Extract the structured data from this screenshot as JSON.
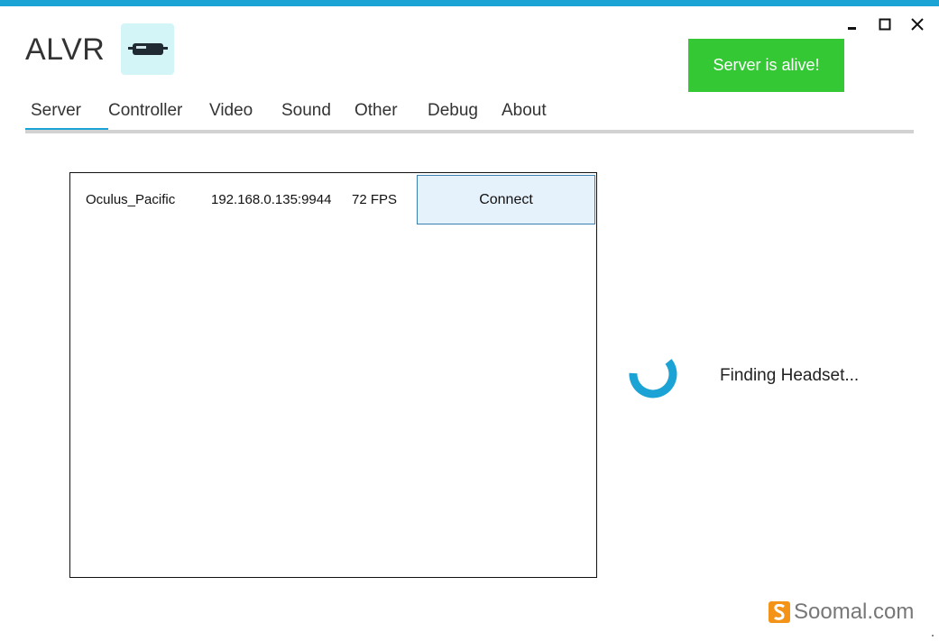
{
  "window": {
    "title": "ALVR",
    "controls": [
      "minimize-icon",
      "maximize-icon",
      "close-icon"
    ]
  },
  "status": {
    "label": "Server is alive!",
    "color": "#34c934"
  },
  "tabs": [
    {
      "label": "Server",
      "active": true
    },
    {
      "label": "Controller"
    },
    {
      "label": "Video"
    },
    {
      "label": "Sound"
    },
    {
      "label": "Other"
    },
    {
      "label": "Debug"
    },
    {
      "label": "About"
    }
  ],
  "devices": [
    {
      "name": "Oculus_Pacific",
      "address": "192.168.0.135:9944",
      "fps": "72 FPS",
      "action": "Connect"
    }
  ],
  "finding": {
    "label": "Finding Headset..."
  },
  "watermark": {
    "text": "Soomal.com"
  },
  "colors": {
    "accent": "#1aa3d4",
    "logo_bg": "#d4f5f7",
    "watermark_logo": "#f39419"
  }
}
